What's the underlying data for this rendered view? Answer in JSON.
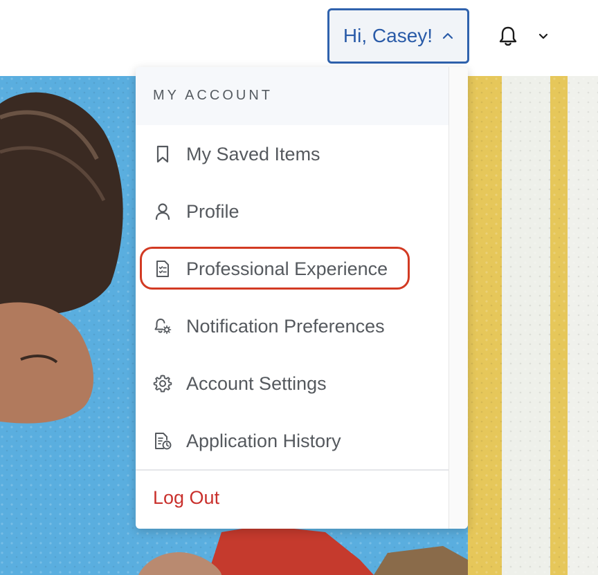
{
  "header": {
    "greeting": "Hi, Casey!",
    "greeting_caret_icon": "chevron-up-icon",
    "notifications_icon": "bell-icon",
    "user_menu_icon": "chevron-down-icon"
  },
  "dropdown": {
    "section_title": "MY ACCOUNT",
    "items": [
      {
        "label": "My Saved Items",
        "icon": "bookmark-icon"
      },
      {
        "label": "Profile",
        "icon": "person-icon"
      },
      {
        "label": "Professional Experience",
        "icon": "checklist-document-icon",
        "highlighted": true
      },
      {
        "label": "Notification Preferences",
        "icon": "bell-gear-icon"
      },
      {
        "label": "Account Settings",
        "icon": "gear-icon"
      },
      {
        "label": "Application History",
        "icon": "document-clock-icon"
      }
    ],
    "logout_label": "Log Out"
  },
  "colors": {
    "accent": "#2f62ad",
    "highlight_ring": "#d23a23",
    "logout": "#c9302c",
    "menu_text": "#55595e"
  }
}
